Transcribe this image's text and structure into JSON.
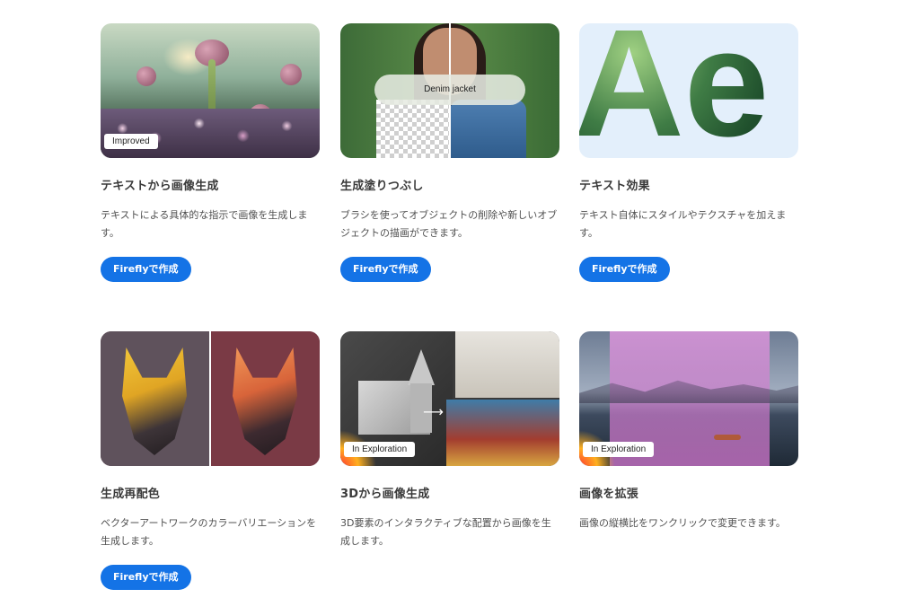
{
  "cards": [
    {
      "title": "テキストから画像生成",
      "description": "テキストによる具体的な指示で画像を生成します。",
      "button": "Fireflyで作成",
      "badge": "Improved"
    },
    {
      "title": "生成塗りつぶし",
      "description": "ブラシを使ってオブジェクトの削除や新しいオブジェクトの描画ができます。",
      "button": "Fireflyで作成",
      "prompt": "Denim jacket"
    },
    {
      "title": "テキスト効果",
      "description": "テキスト自体にスタイルやテクスチャを加えます。",
      "button": "Fireflyで作成",
      "glyphs": "Ae"
    },
    {
      "title": "生成再配色",
      "description": "ベクターアートワークのカラーバリエーションを生成します。",
      "button": "Fireflyで作成"
    },
    {
      "title": "3Dから画像生成",
      "description": "3D要素のインタラクティブな配置から画像を生成します。",
      "badge": "In Exploration"
    },
    {
      "title": "画像を拡張",
      "description": "画像の縦横比をワンクリックで変更できます。",
      "badge": "In Exploration"
    }
  ],
  "colors": {
    "accent": "#1473e6",
    "title": "#3a3a3a",
    "text": "#505050"
  },
  "icons": {
    "arrow": "arrow-right-icon"
  }
}
